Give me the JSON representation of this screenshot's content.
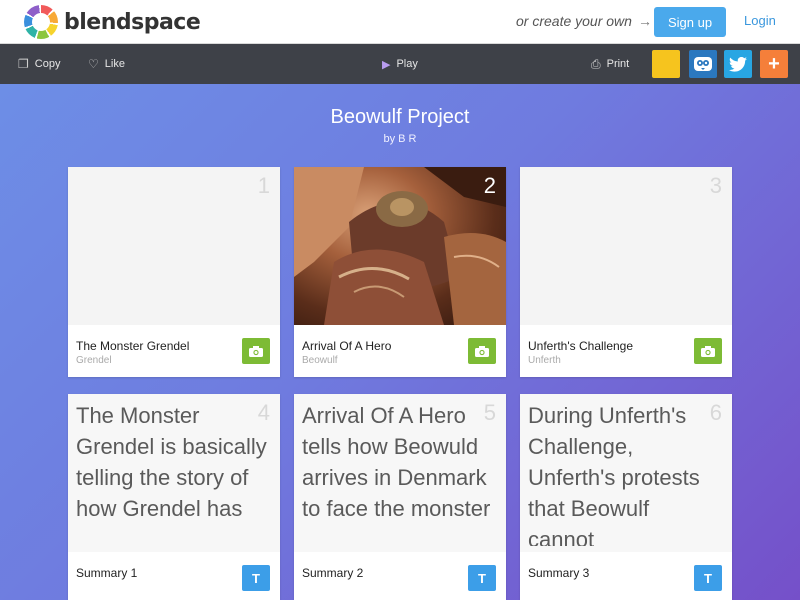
{
  "brand": {
    "name": "blendspace"
  },
  "header": {
    "create_text": "or create your own",
    "signup_label": "Sign up",
    "login_label": "Login"
  },
  "toolbar": {
    "copy_label": "Copy",
    "like_label": "Like",
    "play_label": "Play",
    "print_label": "Print",
    "share_buttons": [
      "yellow-share",
      "blendspace-owl",
      "twitter",
      "add-this"
    ]
  },
  "lesson": {
    "title": "Beowulf Project",
    "byline": "by B R"
  },
  "cards": [
    {
      "number": "1",
      "title": "The Monster Grendel",
      "subtitle": "Grendel",
      "type": "image"
    },
    {
      "number": "2",
      "title": "Arrival Of A Hero",
      "subtitle": "Beowulf",
      "type": "image"
    },
    {
      "number": "3",
      "title": "Unferth's Challenge",
      "subtitle": "Unferth",
      "type": "image"
    },
    {
      "number": "4",
      "title": "Summary 1",
      "body": "The Monster Grendel is basically telling the story of how Grendel has",
      "type": "text"
    },
    {
      "number": "5",
      "title": "Summary 2",
      "body": "Arrival Of A Hero tells how Beowuld arrives in Denmark to face the monster",
      "type": "text"
    },
    {
      "number": "6",
      "title": "Summary 3",
      "body": "During Unferth's Challenge, Unferth's protests that Beowulf cannot",
      "type": "text"
    }
  ],
  "colors": {
    "signup": "#4aa9ec",
    "toolbar": "#3e4148",
    "camera_button": "#7dbb35",
    "text_button": "#3c9ee8",
    "background_start": "#6d8ee6",
    "background_end": "#7550c9"
  }
}
